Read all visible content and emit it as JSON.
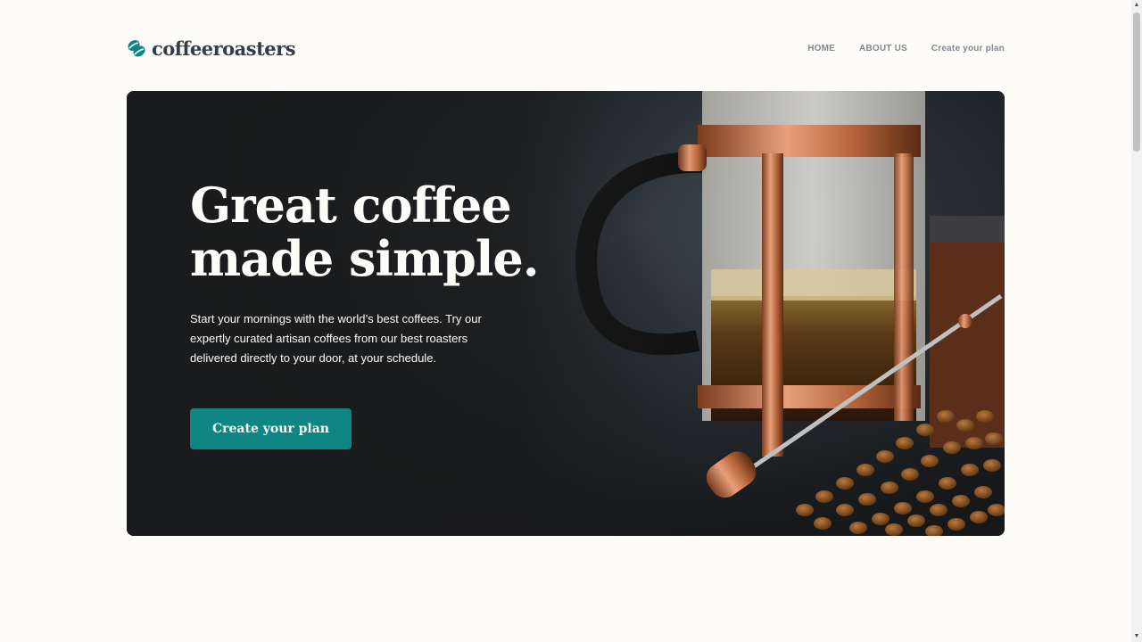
{
  "brand": {
    "name": "coffeeroasters",
    "icon": "coffee-bean-icon",
    "accent_color": "#0e8784",
    "text_color": "#333d4b"
  },
  "nav": {
    "items": [
      {
        "label": "HOME"
      },
      {
        "label": "ABOUT US"
      },
      {
        "label": "Create your plan"
      }
    ]
  },
  "hero": {
    "title_line1": "Great coffee",
    "title_line2": "made simple.",
    "description": "Start your mornings with the world’s best coffees. Try our expertly curated artisan coffees from our best roasters delivered directly to your door, at your schedule.",
    "cta_label": "Create your plan",
    "background_image": "french-press-coffee-beans-photo"
  }
}
